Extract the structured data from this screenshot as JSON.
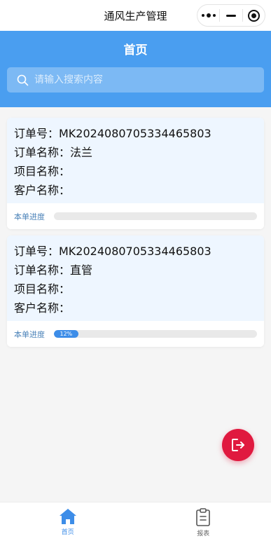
{
  "app": {
    "title": "通风生产管理"
  },
  "header": {
    "title": "首页"
  },
  "search": {
    "placeholder": "请输入搜索内容"
  },
  "orders": [
    {
      "order_no": "订单号：MK2024080705334465803",
      "order_name": "订单名称：法兰",
      "project_name": "项目名称：",
      "customer_name": "客户名称：",
      "progress_label": "本单进度",
      "progress": 0,
      "progress_text": ""
    },
    {
      "order_no": "订单号：MK2024080705334465803",
      "order_name": "订单名称：直管",
      "project_name": "项目名称：",
      "customer_name": "客户名称：",
      "progress_label": "本单进度",
      "progress": 12,
      "progress_text": "12%"
    }
  ],
  "tabbar": {
    "items": [
      {
        "label": "首页",
        "icon": "home-icon",
        "active": true
      },
      {
        "label": "报表",
        "icon": "clipboard-icon",
        "active": false
      }
    ]
  },
  "colors": {
    "primary": "#4a9ef0",
    "progress_fill": "#3d8de8",
    "logout": "#e0193f",
    "card_body": "#eef6ff"
  }
}
